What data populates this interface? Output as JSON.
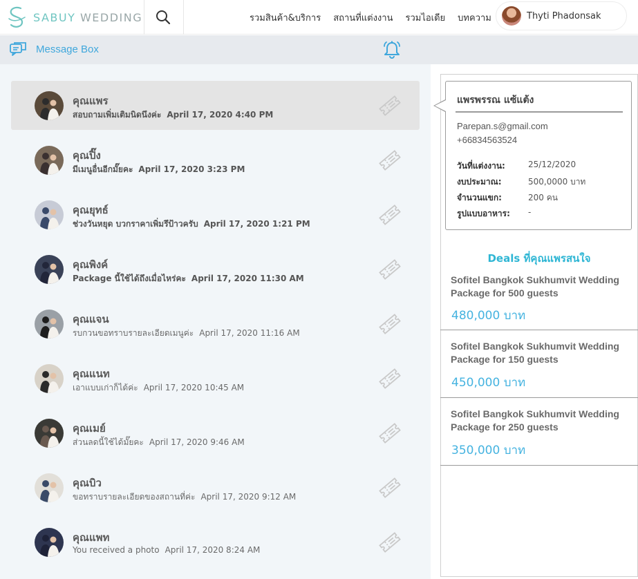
{
  "header": {
    "logo": {
      "brand": "SABUY",
      "suffix": "WEDDING"
    },
    "nav": [
      "รวมสินค้า&บริการ",
      "สถานที่แต่งงาน",
      "รวมไอเดีย",
      "บทความ"
    ],
    "user": {
      "name": "Thyti Phadonsak"
    }
  },
  "subbar": {
    "label": "Message Box"
  },
  "messages": [
    {
      "name": "คุณแพร",
      "preview": "สอบถามเพิ่มเติมนิดนึงค่ะ",
      "time": "April 17, 2020  4:40 PM",
      "unread": true,
      "active": true
    },
    {
      "name": "คุณปิ๊ง",
      "preview": "มีเมนูอื่นอีกมั๊ยคะ",
      "time": "April 17, 2020  3:23 PM",
      "unread": true,
      "active": false
    },
    {
      "name": "คุณยุทธ์",
      "preview": "ช่วงวันหยุด บวกราคาเพิ่มรึป้าวครับ",
      "time": "April 17, 2020  1:21 PM",
      "unread": true,
      "active": false
    },
    {
      "name": "คุณพิงค์",
      "preview": "Package นี้ใช้ได้ถึงเมื่อไหร่คะ",
      "time": "April 17, 2020  11:30 AM",
      "unread": true,
      "active": false
    },
    {
      "name": "คุณแจน",
      "preview": "รบกวนขอทราบรายละเอียดเมนูค่ะ",
      "time": "April 17, 2020  11:16 AM",
      "unread": false,
      "active": false
    },
    {
      "name": "คุณแนท",
      "preview": "เอาแบบเก่าก็ได้ค่ะ",
      "time": "April 17, 2020  10:45 AM",
      "unread": false,
      "active": false
    },
    {
      "name": "คุณเมย์",
      "preview": "ส่วนลดนี้ใช้ได้มั๊ยคะ",
      "time": "April 17, 2020  9:46 AM",
      "unread": false,
      "active": false
    },
    {
      "name": "คุณบิว",
      "preview": "ขอทราบรายละเอียดของสถานที่ค่ะ",
      "time": "April 17, 2020  9:12 AM",
      "unread": false,
      "active": false
    },
    {
      "name": "คุณแพท",
      "preview": "You received a photo",
      "time": "April 17, 2020  8:24 AM",
      "unread": false,
      "active": false
    }
  ],
  "contact": {
    "name": "แพรพรรณ แซ้แต้ง",
    "email": "Parepan.s@gmail.com",
    "phone": "+66834563524",
    "fields": [
      {
        "label": "วันที่แต่งงาน:",
        "value": "25/12/2020"
      },
      {
        "label": "งบประมาณ:",
        "value": "500,0000 บาท"
      },
      {
        "label": "จำนวนแขก:",
        "value": "200 คน"
      },
      {
        "label": "รูปแบบอาหาร:",
        "value": "-"
      }
    ]
  },
  "deals": {
    "title": "Deals ที่คุณแพรสนใจ",
    "items": [
      {
        "name": "Sofitel Bangkok Sukhumvit Wedding Package for 500 guests",
        "price": "480,000",
        "unit": "บาท"
      },
      {
        "name": "Sofitel Bangkok Sukhumvit Wedding Package for 150 guests",
        "price": "450,000",
        "unit": "บาท"
      },
      {
        "name": "Sofitel Bangkok Sukhumvit Wedding Package for 250 guests",
        "price": "350,000",
        "unit": "บาท"
      }
    ]
  },
  "colors": {
    "accent": "#3fa7dc",
    "deal_title": "#2fb6d4",
    "brand": "#6fc5c1"
  }
}
